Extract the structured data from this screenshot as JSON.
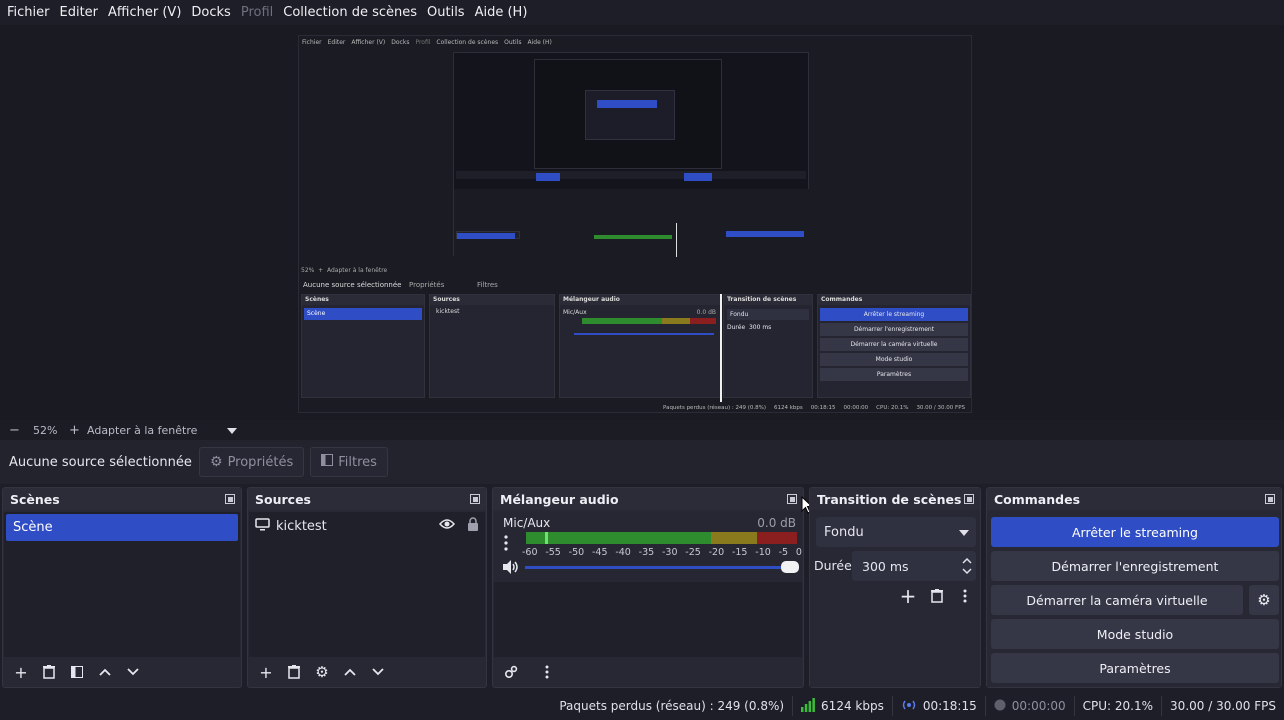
{
  "menu": [
    "Fichier",
    "Editer",
    "Afficher (V)",
    "Docks",
    "Profil",
    "Collection de scènes",
    "Outils",
    "Aide (H)"
  ],
  "menu_disabled_index": 4,
  "preview": {
    "mini_menu": [
      "Fichier",
      "Editer",
      "Afficher (V)",
      "Docks",
      "Profil",
      "Collection de scènes",
      "Outils",
      "Aide (H)"
    ],
    "mini_source": "Aucune source sélectionnée",
    "mini_props": "Propriétés",
    "mini_filters": "Filtres",
    "mini_zoom": "52%",
    "mini_fit": "Adapter à la fenêtre",
    "mini_panels": [
      "Scènes",
      "Sources",
      "Mélangeur audio",
      "Transition de scènes",
      "Commandes"
    ],
    "mini_scene": "Scène",
    "mini_source_item": "kicktest",
    "mini_mixer_label": "Mic/Aux",
    "mini_mixer_db": "0.0 dB",
    "mini_transition": "Fondu",
    "mini_duration_label": "Durée",
    "mini_duration": "300 ms",
    "mini_commands": [
      "Arrêter le streaming",
      "Démarrer l'enregistrement",
      "Démarrer la caméra virtuelle",
      "Mode studio",
      "Paramètres"
    ],
    "mini_status": [
      "Paquets perdus (réseau) : 249 (0.8%)",
      "6124 kbps",
      "00:18:15",
      "00:00:00",
      "CPU: 20.1%",
      "30.00 / 30.00 FPS"
    ]
  },
  "zoom": {
    "minus": "−",
    "value": "52%",
    "plus": "+",
    "fit_label": "Adapter à la fenêtre"
  },
  "props": {
    "no_source": "Aucune source sélectionnée",
    "properties_label": "Propriétés",
    "filters_label": "Filtres"
  },
  "scenes": {
    "title": "Scènes",
    "items": [
      "Scène"
    ]
  },
  "sources": {
    "title": "Sources",
    "items": [
      "kicktest"
    ]
  },
  "mixer": {
    "title": "Mélangeur audio",
    "channel": "Mic/Aux",
    "db": "0.0 dB",
    "ticks": [
      "-60",
      "-55",
      "-50",
      "-45",
      "-40",
      "-35",
      "-30",
      "-25",
      "-20",
      "-15",
      "-10",
      "-5",
      "0"
    ],
    "volume_fraction": 1.0
  },
  "transition": {
    "title": "Transition de scènes",
    "selected": "Fondu",
    "duration_label": "Durée",
    "duration_value": "300 ms"
  },
  "commands": {
    "title": "Commandes",
    "buttons": [
      "Arrêter le streaming",
      "Démarrer l'enregistrement",
      "Démarrer la caméra virtuelle",
      "Mode studio",
      "Paramètres"
    ]
  },
  "status": {
    "dropped": "Paquets perdus (réseau) : 249 (0.8%)",
    "bitrate": "6124 kbps",
    "stream_time": "00:18:15",
    "rec_time": "00:00:00",
    "cpu": "CPU: 20.1%",
    "fps": "30.00 / 30.00 FPS"
  },
  "colors": {
    "accent": "#2f4ec5",
    "meter_green": "#2e8b2e",
    "meter_yellow": "#8a7a1e",
    "meter_red": "#8b1f1f",
    "bitrate_green": "#3bbf3b"
  }
}
